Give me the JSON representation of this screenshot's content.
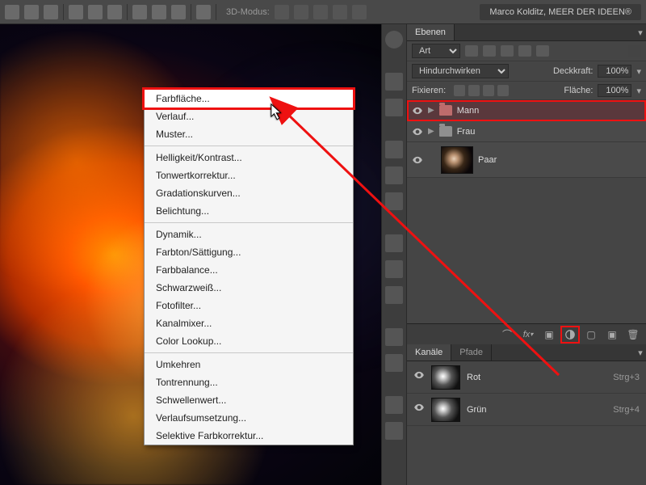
{
  "topbar": {
    "mode3d": "3D-Modus:",
    "username": "Marco Kolditz, MEER DER IDEEN®"
  },
  "layers_panel": {
    "title": "Ebenen",
    "filter": "Art",
    "blend_mode": "Hindurchwirken",
    "opacity_label": "Deckkraft:",
    "opacity_value": "100%",
    "lock_label": "Fixieren:",
    "fill_label": "Fläche:",
    "fill_value": "100%",
    "items": [
      {
        "name": "Mann",
        "selected": true,
        "type": "folder"
      },
      {
        "name": "Frau",
        "selected": false,
        "type": "folder"
      },
      {
        "name": "Paar",
        "selected": false,
        "type": "layer"
      }
    ]
  },
  "channels_panel": {
    "tab1": "Kanäle",
    "tab2": "Pfade",
    "items": [
      {
        "name": "Rot",
        "shortcut": "Strg+3"
      },
      {
        "name": "Grün",
        "shortcut": "Strg+4"
      }
    ]
  },
  "context_menu": {
    "groups": [
      [
        "Farbfläche...",
        "Verlauf...",
        "Muster..."
      ],
      [
        "Helligkeit/Kontrast...",
        "Tonwertkorrektur...",
        "Gradationskurven...",
        "Belichtung..."
      ],
      [
        "Dynamik...",
        "Farbton/Sättigung...",
        "Farbbalance...",
        "Schwarzweiß...",
        "Fotofilter...",
        "Kanalmixer...",
        "Color Lookup..."
      ],
      [
        "Umkehren",
        "Tontrennung...",
        "Schwellenwert...",
        "Verlaufsumsetzung...",
        "Selektive Farbkorrektur..."
      ]
    ]
  }
}
